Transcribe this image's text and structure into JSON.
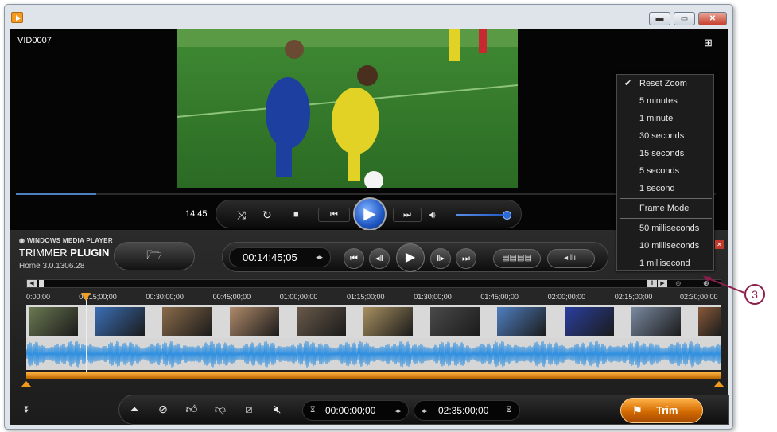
{
  "video": {
    "title": "VID0007",
    "current_time": "14:45",
    "progress_fraction": 0.115
  },
  "player": {
    "volume_fraction": 0.88
  },
  "brand": {
    "line1": "WINDOWS MEDIA PLAYER",
    "line2a": "TRIMMER ",
    "line2b": "PLUGIN",
    "version": "Home 3.0.1306.28"
  },
  "transport": {
    "timecode": "00:14:45;05"
  },
  "timeline": {
    "ticks": [
      "0:00;00",
      "00:15;00;00",
      "00:30;00;00",
      "00:45;00;00",
      "01:00;00;00",
      "01:15;00;00",
      "01:30;00;00",
      "01:45;00;00",
      "02:00;00;00",
      "02:15;00;00",
      "02:30;00;00"
    ],
    "playhead_fraction": 0.097
  },
  "bottom": {
    "start_time": "00:00:00;00",
    "end_time": "02:35:00;00",
    "trim_label": "Trim"
  },
  "zoom_menu": {
    "items": [
      {
        "label": "Reset Zoom",
        "checked": true
      },
      {
        "label": "5 minutes"
      },
      {
        "label": "1 minute"
      },
      {
        "label": "30 seconds"
      },
      {
        "label": "15 seconds"
      },
      {
        "label": "5 seconds"
      },
      {
        "label": "1 second"
      },
      {
        "label": "Frame Mode"
      },
      {
        "label": "50 milliseconds"
      },
      {
        "label": "10 milliseconds"
      },
      {
        "label": "1 millisecond"
      }
    ]
  },
  "callout": {
    "number": "3"
  },
  "colors": {
    "accent_blue": "#1f57c2",
    "trim_orange": "#d36a00",
    "waveform": "#2f8fe0",
    "callout": "#8e1d4b"
  }
}
